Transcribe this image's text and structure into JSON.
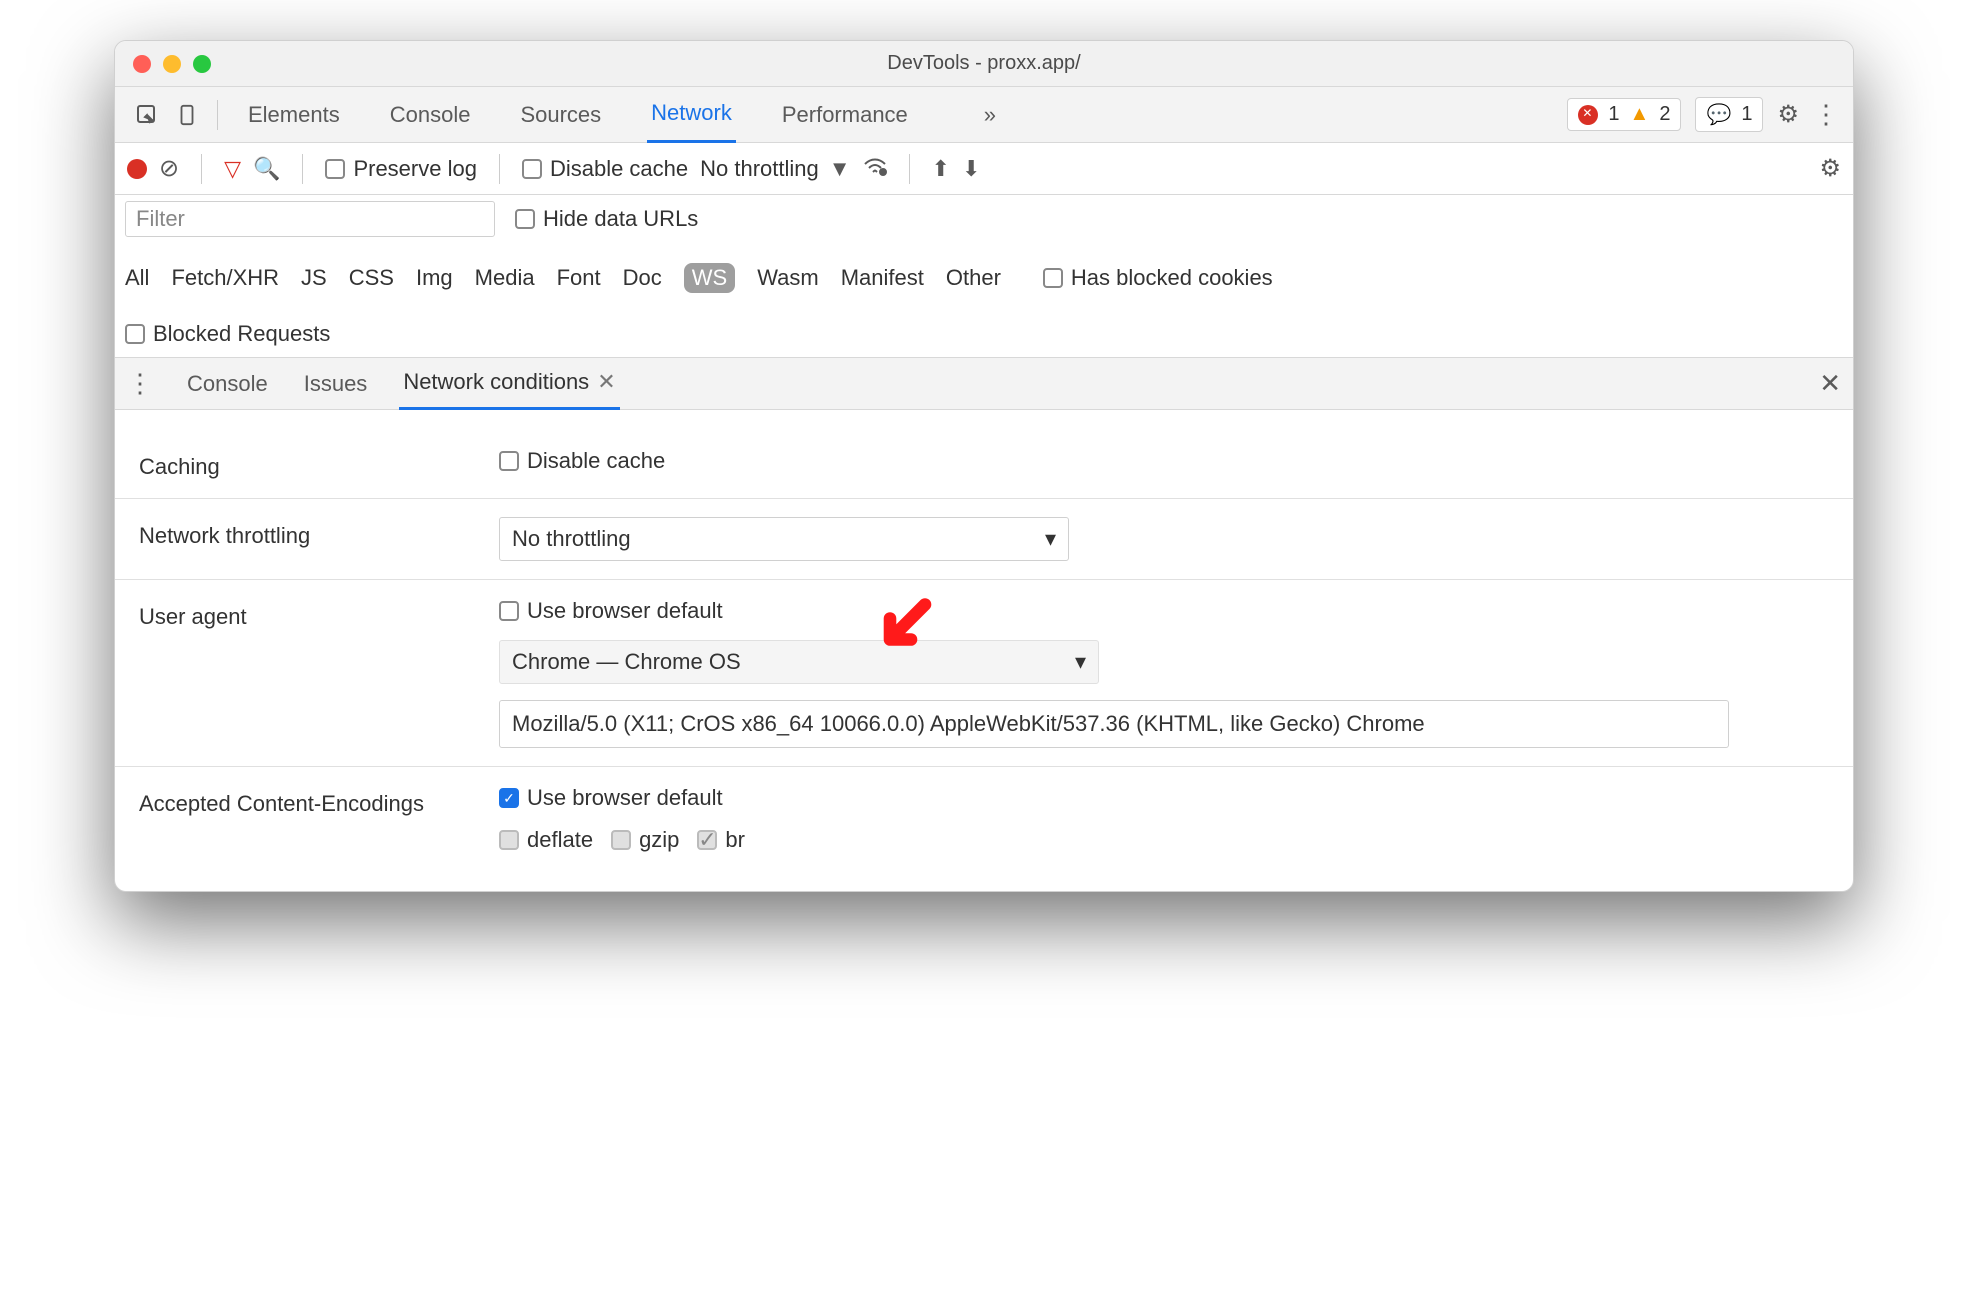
{
  "window": {
    "title": "DevTools - proxx.app/"
  },
  "tabs": {
    "items": [
      "Elements",
      "Console",
      "Sources",
      "Network",
      "Performance"
    ],
    "active": "Network",
    "errors": "1",
    "warnings": "2",
    "messages": "1"
  },
  "network_toolbar": {
    "preserve_log": "Preserve log",
    "disable_cache": "Disable cache",
    "throttling": "No throttling"
  },
  "filter": {
    "placeholder": "Filter",
    "hide_data_urls": "Hide data URLs",
    "types": [
      "All",
      "Fetch/XHR",
      "JS",
      "CSS",
      "Img",
      "Media",
      "Font",
      "Doc",
      "WS",
      "Wasm",
      "Manifest",
      "Other"
    ],
    "has_blocked_cookies": "Has blocked cookies",
    "blocked_requests": "Blocked Requests"
  },
  "drawer": {
    "tabs": [
      "Console",
      "Issues",
      "Network conditions"
    ],
    "active": "Network conditions"
  },
  "conditions": {
    "caching_label": "Caching",
    "caching_disable": "Disable cache",
    "throttling_label": "Network throttling",
    "throttling_value": "No throttling",
    "ua_label": "User agent",
    "ua_use_default": "Use browser default",
    "ua_select": "Chrome — Chrome OS",
    "ua_string": "Mozilla/5.0 (X11; CrOS x86_64 10066.0.0) AppleWebKit/537.36 (KHTML, like Gecko) Chrome",
    "enc_label": "Accepted Content-Encodings",
    "enc_use_default": "Use browser default",
    "enc_options": [
      "deflate",
      "gzip",
      "br"
    ]
  }
}
